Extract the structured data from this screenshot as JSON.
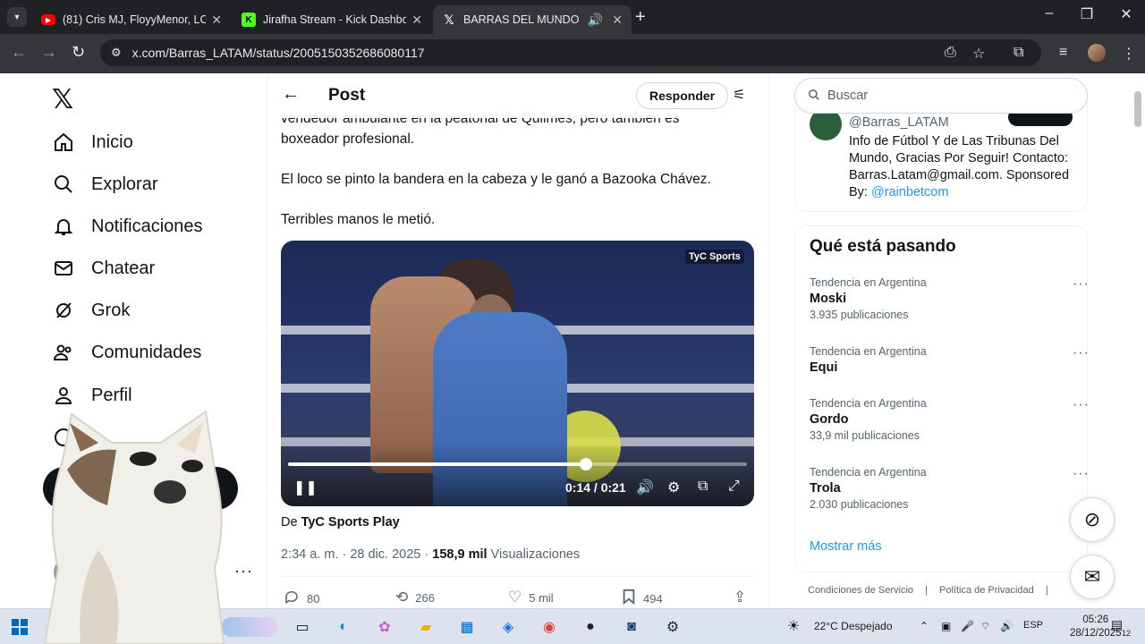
{
  "browser": {
    "tabs": [
      {
        "title": "(81) Cris MJ, FloyyMenor, LOUK",
        "favicon": "youtube-icon"
      },
      {
        "title": "Jirafha Stream - Kick Dashboard",
        "favicon": "kick-icon"
      },
      {
        "title": "BARRAS DEL MUNDO",
        "favicon": "x-icon"
      }
    ],
    "url": "x.com/Barras_LATAM/status/2005150352686080117"
  },
  "nav": {
    "items": [
      {
        "label": "Inicio",
        "icon": "home-icon"
      },
      {
        "label": "Explorar",
        "icon": "search-icon"
      },
      {
        "label": "Notificaciones",
        "icon": "bell-icon"
      },
      {
        "label": "Chatear",
        "icon": "mail-icon"
      },
      {
        "label": "Grok",
        "icon": "grok-icon"
      },
      {
        "label": "Comunidades",
        "icon": "people-icon"
      },
      {
        "label": "Perfil",
        "icon": "person-icon"
      }
    ]
  },
  "header": {
    "title": "Post",
    "reply_label": "Responder"
  },
  "tweet": {
    "lines": [
      "vendedor ambulante en la peatonal de Quilmes, pero también es",
      "boxeador profesional.",
      "El loco se pinto la bandera en la cabeza y le ganó a Bazooka Chávez.",
      "Terribles manos le metió."
    ],
    "video": {
      "time": "0:14 / 0:21",
      "progress": 0.65,
      "watermark": "TyC Sports"
    },
    "from_prefix": "De",
    "from_source": "TyC Sports Play",
    "timestamp": "2:34 a. m. · 28 dic. 2025 · ",
    "views_count": "158,9 mil",
    "views_label": " Visualizaciones",
    "actions": {
      "replies": "80",
      "reposts": "266",
      "likes": "5 mil",
      "bookmarks": "494"
    }
  },
  "sidebar": {
    "search_placeholder": "Buscar",
    "profile": {
      "handle": "@Barras_LATAM",
      "bio": "Info de Fútbol Y de Las Tribunas Del Mundo, Gracias Por Seguir! Contacto: Barras.Latam@gmail.com. Sponsored By: ",
      "bio_link": "@rainbetcom"
    },
    "trends_title": "Qué está pasando",
    "trends": [
      {
        "context": "Tendencia en Argentina",
        "name": "Moski",
        "count": "3.935 publicaciones"
      },
      {
        "context": "Tendencia en Argentina",
        "name": "Equi",
        "count": ""
      },
      {
        "context": "Tendencia en Argentina",
        "name": "Gordo",
        "count": "33,9 mil publicaciones"
      },
      {
        "context": "Tendencia en Argentina",
        "name": "Trola",
        "count": "2.030 publicaciones"
      }
    ],
    "show_more": "Mostrar más",
    "footer": [
      "Condiciones de Servicio",
      "|",
      "Política de Privacidad",
      "|"
    ]
  },
  "taskbar": {
    "weather": "22°C Despejado",
    "lang": "ESP",
    "time": "05:26",
    "date": "28/12/2025",
    "notifications": "12"
  }
}
